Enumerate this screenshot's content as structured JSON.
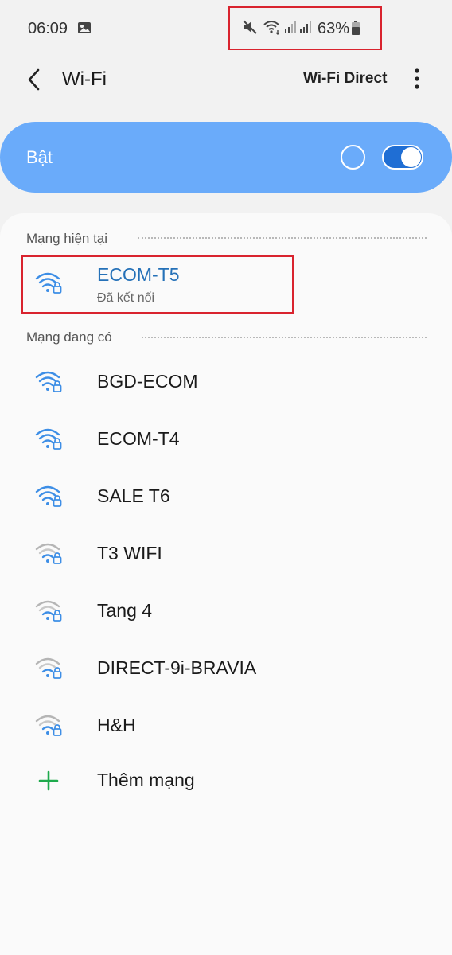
{
  "status_bar": {
    "time": "06:09",
    "battery": "63%"
  },
  "header": {
    "title": "Wi-Fi",
    "wifi_direct_label": "Wi-Fi Direct"
  },
  "toggle": {
    "label": "Bật",
    "state": "on",
    "accent_color": "#6aabfa"
  },
  "current_section": {
    "heading": "Mạng hiện tại",
    "network": {
      "name": "ECOM-T5",
      "status": "Đã kết nối"
    }
  },
  "available_section": {
    "heading": "Mạng đang có",
    "networks": [
      {
        "name": "BGD-ECOM",
        "signal": "strong"
      },
      {
        "name": "ECOM-T4",
        "signal": "strong"
      },
      {
        "name": "SALE T6",
        "signal": "strong"
      },
      {
        "name": "T3 WIFI",
        "signal": "weak"
      },
      {
        "name": "Tang 4",
        "signal": "weak"
      },
      {
        "name": "DIRECT-9i-BRAVIA",
        "signal": "weak"
      },
      {
        "name": "H&H",
        "signal": "weak"
      }
    ]
  },
  "add_network_label": "Thêm mạng"
}
